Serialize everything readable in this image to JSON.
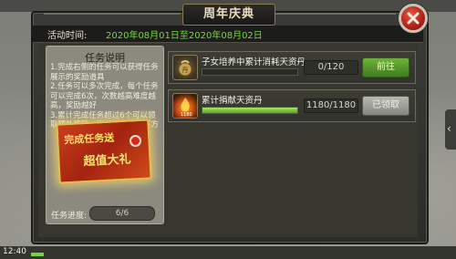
{
  "title": "周年庆典",
  "activity": {
    "label": "活动时间:",
    "value": "2020年08月01日至2020年08月02日"
  },
  "task_panel": {
    "title": "任务说明",
    "description": "1.完成右侧的任务可以获得任务展示的奖励道具\n2.任务可以多次完成，每个任务可以完成6次，次数越高难度越高，奖励越好\n3.累计完成任务超过6个可以领取额外奖励，当前进度存在下方",
    "reward_text_1": "完成任务送",
    "reward_text_2": "超值大礼",
    "progress_label": "任务进度:",
    "progress_value": "6/6"
  },
  "tasks": [
    {
      "name": "子女培养中累计消耗天资丹",
      "progress": "0/120",
      "progress_fraction": 0,
      "button": "前往",
      "icon": "pouch-icon",
      "accent": "#6db33a"
    },
    {
      "name": "累计捐献天资丹",
      "progress": "1180/1180",
      "progress_fraction": 1,
      "button": "已领取",
      "icon": "fire-icon",
      "icon_badge": "1180",
      "accent": "#a0a09a"
    }
  ],
  "status_bar": {
    "time": "12:40"
  },
  "side_tab": {
    "arrow": "‹"
  },
  "colors": {
    "accent_green": "#74d93f",
    "close_red": "#c02a1c",
    "reward_gold": "#ffe36b"
  }
}
